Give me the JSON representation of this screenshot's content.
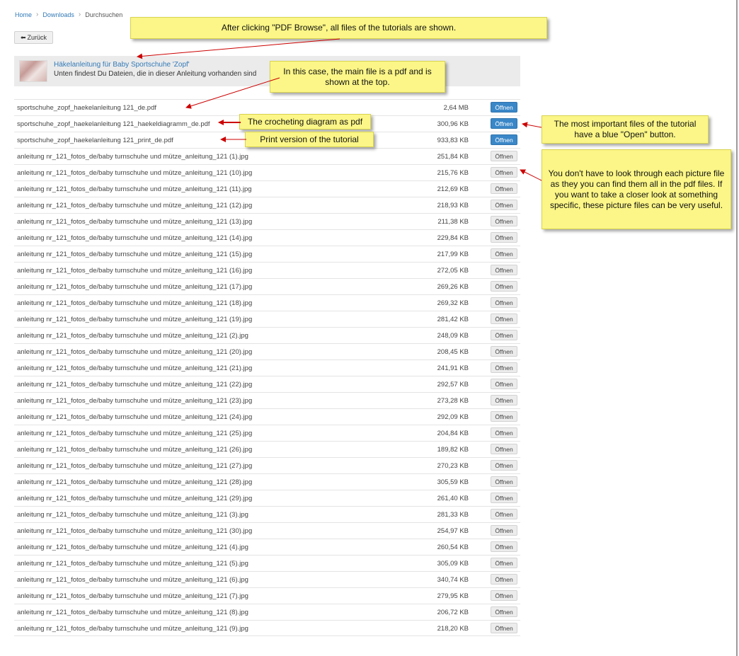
{
  "breadcrumb": {
    "home": "Home",
    "downloads": "Downloads",
    "current": "Durchsuchen"
  },
  "back_button": {
    "label": "Zurück",
    "icon": "arrow-left-icon"
  },
  "tutorial": {
    "title": "Häkelanleitung für Baby Sportschuhe 'Zopf'",
    "subtitle": "Unten findest Du Dateien, die in dieser Anleitung vorhanden sind"
  },
  "open_label": "Öffnen",
  "colors": {
    "primary_button": "#3a87c8",
    "link": "#337ab7",
    "callout": "#fbf687",
    "arrow": "#cc0000"
  },
  "files": [
    {
      "name": "sportschuhe_zopf_haekelanleitung 121_de.pdf",
      "size": "2,64 MB",
      "primary": true
    },
    {
      "name": "sportschuhe_zopf_haekelanleitung 121_haekeldiagramm_de.pdf",
      "size": "300,96 KB",
      "primary": true
    },
    {
      "name": "sportschuhe_zopf_haekelanleitung 121_print_de.pdf",
      "size": "933,83 KB",
      "primary": true
    },
    {
      "name": "anleitung nr_121_fotos_de/baby turnschuhe und mütze_anleitung_121 (1).jpg",
      "size": "251,84 KB",
      "primary": false
    },
    {
      "name": "anleitung nr_121_fotos_de/baby turnschuhe und mütze_anleitung_121 (10).jpg",
      "size": "215,76 KB",
      "primary": false
    },
    {
      "name": "anleitung nr_121_fotos_de/baby turnschuhe und mütze_anleitung_121 (11).jpg",
      "size": "212,69 KB",
      "primary": false
    },
    {
      "name": "anleitung nr_121_fotos_de/baby turnschuhe und mütze_anleitung_121 (12).jpg",
      "size": "218,93 KB",
      "primary": false
    },
    {
      "name": "anleitung nr_121_fotos_de/baby turnschuhe und mütze_anleitung_121 (13).jpg",
      "size": "211,38 KB",
      "primary": false
    },
    {
      "name": "anleitung nr_121_fotos_de/baby turnschuhe und mütze_anleitung_121 (14).jpg",
      "size": "229,84 KB",
      "primary": false
    },
    {
      "name": "anleitung nr_121_fotos_de/baby turnschuhe und mütze_anleitung_121 (15).jpg",
      "size": "217,99 KB",
      "primary": false
    },
    {
      "name": "anleitung nr_121_fotos_de/baby turnschuhe und mütze_anleitung_121 (16).jpg",
      "size": "272,05 KB",
      "primary": false
    },
    {
      "name": "anleitung nr_121_fotos_de/baby turnschuhe und mütze_anleitung_121 (17).jpg",
      "size": "269,26 KB",
      "primary": false
    },
    {
      "name": "anleitung nr_121_fotos_de/baby turnschuhe und mütze_anleitung_121 (18).jpg",
      "size": "269,32 KB",
      "primary": false
    },
    {
      "name": "anleitung nr_121_fotos_de/baby turnschuhe und mütze_anleitung_121 (19).jpg",
      "size": "281,42 KB",
      "primary": false
    },
    {
      "name": "anleitung nr_121_fotos_de/baby turnschuhe und mütze_anleitung_121 (2).jpg",
      "size": "248,09 KB",
      "primary": false
    },
    {
      "name": "anleitung nr_121_fotos_de/baby turnschuhe und mütze_anleitung_121 (20).jpg",
      "size": "208,45 KB",
      "primary": false
    },
    {
      "name": "anleitung nr_121_fotos_de/baby turnschuhe und mütze_anleitung_121 (21).jpg",
      "size": "241,91 KB",
      "primary": false
    },
    {
      "name": "anleitung nr_121_fotos_de/baby turnschuhe und mütze_anleitung_121 (22).jpg",
      "size": "292,57 KB",
      "primary": false
    },
    {
      "name": "anleitung nr_121_fotos_de/baby turnschuhe und mütze_anleitung_121 (23).jpg",
      "size": "273,28 KB",
      "primary": false
    },
    {
      "name": "anleitung nr_121_fotos_de/baby turnschuhe und mütze_anleitung_121 (24).jpg",
      "size": "292,09 KB",
      "primary": false
    },
    {
      "name": "anleitung nr_121_fotos_de/baby turnschuhe und mütze_anleitung_121 (25).jpg",
      "size": "204,84 KB",
      "primary": false
    },
    {
      "name": "anleitung nr_121_fotos_de/baby turnschuhe und mütze_anleitung_121 (26).jpg",
      "size": "189,82 KB",
      "primary": false
    },
    {
      "name": "anleitung nr_121_fotos_de/baby turnschuhe und mütze_anleitung_121 (27).jpg",
      "size": "270,23 KB",
      "primary": false
    },
    {
      "name": "anleitung nr_121_fotos_de/baby turnschuhe und mütze_anleitung_121 (28).jpg",
      "size": "305,59 KB",
      "primary": false
    },
    {
      "name": "anleitung nr_121_fotos_de/baby turnschuhe und mütze_anleitung_121 (29).jpg",
      "size": "261,40 KB",
      "primary": false
    },
    {
      "name": "anleitung nr_121_fotos_de/baby turnschuhe und mütze_anleitung_121 (3).jpg",
      "size": "281,33 KB",
      "primary": false
    },
    {
      "name": "anleitung nr_121_fotos_de/baby turnschuhe und mütze_anleitung_121 (30).jpg",
      "size": "254,97 KB",
      "primary": false
    },
    {
      "name": "anleitung nr_121_fotos_de/baby turnschuhe und mütze_anleitung_121 (4).jpg",
      "size": "260,54 KB",
      "primary": false
    },
    {
      "name": "anleitung nr_121_fotos_de/baby turnschuhe und mütze_anleitung_121 (5).jpg",
      "size": "305,09 KB",
      "primary": false
    },
    {
      "name": "anleitung nr_121_fotos_de/baby turnschuhe und mütze_anleitung_121 (6).jpg",
      "size": "340,74 KB",
      "primary": false
    },
    {
      "name": "anleitung nr_121_fotos_de/baby turnschuhe und mütze_anleitung_121 (7).jpg",
      "size": "279,95 KB",
      "primary": false
    },
    {
      "name": "anleitung nr_121_fotos_de/baby turnschuhe und mütze_anleitung_121 (8).jpg",
      "size": "206,72 KB",
      "primary": false
    },
    {
      "name": "anleitung nr_121_fotos_de/baby turnschuhe und mütze_anleitung_121 (9).jpg",
      "size": "218,20 KB",
      "primary": false
    }
  ],
  "callouts": {
    "pdf_browse": "After clicking \"PDF Browse\", all files of the tutorials are shown.",
    "main_file": "In this case, the main file is a pdf and is shown at the top.",
    "diagram": "The crocheting diagram as pdf",
    "print": "Print version of the tutorial",
    "open_button": "The most important files of the tutorial have a blue \"Open\" button.",
    "pictures": "You don't have to look through each picture file as they you can find them all in the pdf files. If you want to take a closer look at something specific, these picture files can be very useful."
  }
}
